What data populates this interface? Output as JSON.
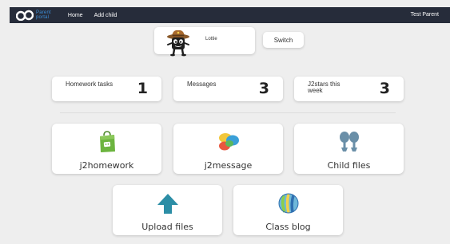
{
  "header": {
    "logo_line1": "Parent",
    "logo_line2": "portal",
    "nav": [
      "Home",
      "Add child"
    ],
    "user": "Test Parent"
  },
  "child": {
    "name": "Lottie",
    "switch_label": "Switch"
  },
  "stats": [
    {
      "label": "Homework tasks",
      "value": "1"
    },
    {
      "label": "Messages",
      "value": "3"
    },
    {
      "label": "J2stars this week",
      "value": "3"
    }
  ],
  "tiles": [
    {
      "label": "j2homework",
      "icon": "homework-bag-icon"
    },
    {
      "label": "j2message",
      "icon": "message-bubbles-icon"
    },
    {
      "label": "Child files",
      "icon": "child-files-icon"
    },
    {
      "label": "Upload files",
      "icon": "upload-arrow-icon"
    },
    {
      "label": "Class blog",
      "icon": "class-blog-icon"
    }
  ],
  "colors": {
    "topbar": "#262c3a",
    "logo_blue": "#3c8fd9",
    "background": "#eeeeee",
    "homework_green": "#6cb43f",
    "upload_teal": "#2c8ea6",
    "files_blue": "#6a8fa8"
  }
}
